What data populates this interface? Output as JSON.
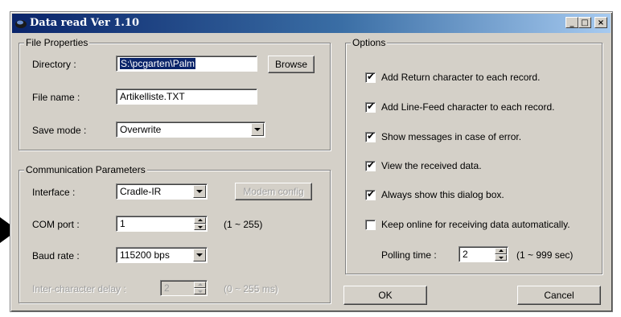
{
  "window": {
    "title": "Data read  Ver 1.10"
  },
  "file_properties": {
    "legend": "File Properties",
    "directory_label": "Directory :",
    "directory_value": "S:\\pcgarten\\Palm",
    "browse_label": "Browse",
    "filename_label": "File name :",
    "filename_value": "Artikelliste.TXT",
    "save_mode_label": "Save mode :",
    "save_mode_value": "Overwrite"
  },
  "communication": {
    "legend": "Communication Parameters",
    "interface_label": "Interface :",
    "interface_value": "Cradle-IR",
    "modem_config_label": "Modem config",
    "com_port_label": "COM port :",
    "com_port_value": "1",
    "com_port_range": "(1 ~ 255)",
    "baud_rate_label": "Baud rate :",
    "baud_rate_value": "115200 bps",
    "inter_char_label": "Inter-character delay :",
    "inter_char_value": "2",
    "inter_char_range": "(0 ~ 255 ms)"
  },
  "options": {
    "legend": "Options",
    "items": [
      {
        "label": "Add Return character to each record.",
        "checked": true
      },
      {
        "label": "Add Line-Feed character to each record.",
        "checked": true
      },
      {
        "label": "Show messages in case of error.",
        "checked": true
      },
      {
        "label": "View the received data.",
        "checked": true
      },
      {
        "label": "Always show this dialog box.",
        "checked": true
      },
      {
        "label": "Keep online for receiving data automatically.",
        "checked": false
      }
    ],
    "polling_label": "Polling time :",
    "polling_value": "2",
    "polling_range": "(1 ~ 999 sec)"
  },
  "buttons": {
    "ok": "OK",
    "cancel": "Cancel"
  },
  "icons": {
    "app": "drive-icon",
    "minimize": "minimize-icon",
    "maximize": "maximize-icon",
    "close": "close-icon",
    "pointer": "pointer-arrow-icon",
    "dropdown": "chevron-down-icon",
    "spinner_up": "spin-up-icon",
    "spinner_down": "spin-down-icon",
    "check": "check-icon"
  },
  "glyphs": {
    "minimize": "_",
    "maximize": "□",
    "close": "×",
    "check": "✔"
  },
  "colors": {
    "titlebar_start": "#0a246a",
    "titlebar_end": "#a6caf0",
    "dialog_face": "#d4d0c8"
  }
}
